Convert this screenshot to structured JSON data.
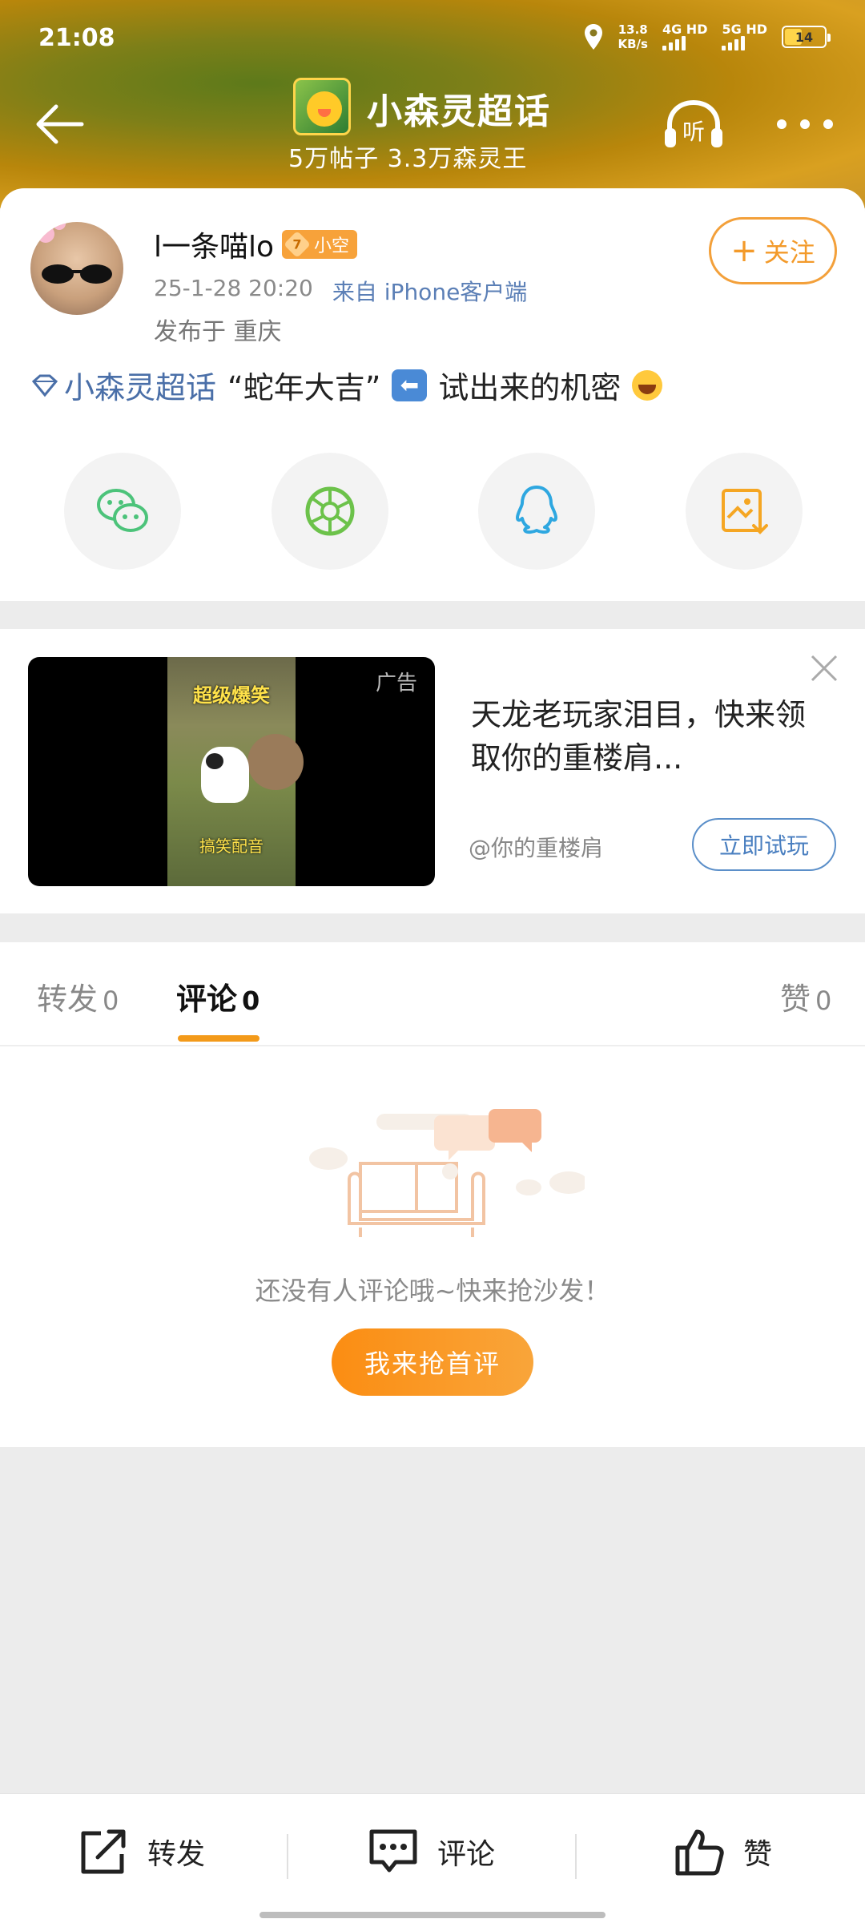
{
  "status_bar": {
    "time": "21:08",
    "net_speed_value": "13.8",
    "net_speed_unit": "KB/s",
    "net1": "4G HD",
    "net2": "5G HD",
    "battery": "14"
  },
  "header": {
    "title": "小森灵超话",
    "subtitle": "5万帖子 3.3万森灵王",
    "listen_label": "听"
  },
  "post": {
    "username": "l一条喵lo",
    "level": "7",
    "level_tag": "小空",
    "timestamp": "25-1-28 20:20",
    "source": "来自 iPhone客户端",
    "location": "发布于 重庆",
    "follow_label": "关注",
    "topic": "小森灵超话",
    "text_quote": "“蛇年大吉”",
    "text_tail": "试出来的机密"
  },
  "share": {
    "items": [
      "wechat-icon",
      "moments-icon",
      "qq-icon",
      "save-image-icon"
    ]
  },
  "ad": {
    "tag": "广告",
    "caption_top": "超级爆笑",
    "caption_bottom": "搞笑配音",
    "title": "天龙老玩家泪目，快来领取你的重楼肩...",
    "source": "@你的重楼肩",
    "cta": "立即试玩"
  },
  "tabs": {
    "repost_label": "转发",
    "repost_count": "0",
    "comment_label": "评论",
    "comment_count": "0",
    "like_label": "赞",
    "like_count": "0"
  },
  "empty": {
    "message": "还没有人评论哦~快来抢沙发！",
    "button": "我来抢首评"
  },
  "bottom_bar": {
    "repost": "转发",
    "comment": "评论",
    "like": "赞"
  },
  "colors": {
    "accent": "#f39a1a",
    "link": "#4a6fa8"
  }
}
